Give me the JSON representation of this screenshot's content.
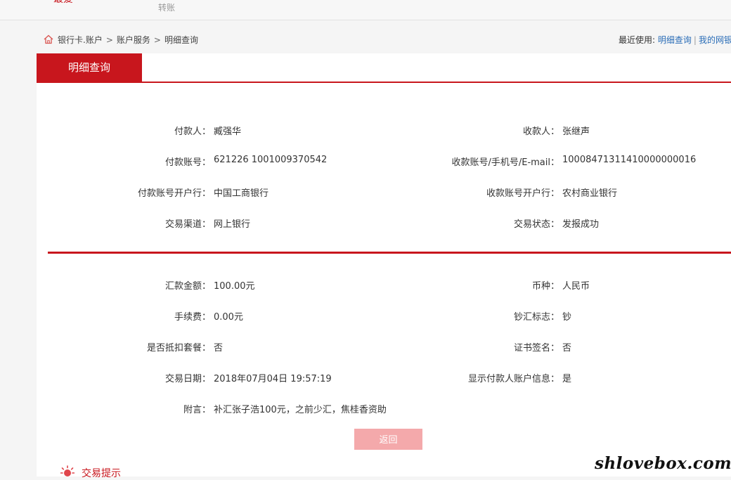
{
  "topbar": {
    "active_tab": "最爱",
    "transfer_tab": "转账"
  },
  "breadcrumb": {
    "items": [
      "银行卡.账户",
      "账户服务",
      "明细查询"
    ],
    "separator": ">"
  },
  "recent": {
    "label": "最近使用:",
    "links": [
      "明细查询",
      "我的网银"
    ],
    "divider": "|"
  },
  "panel": {
    "tab_title": "明细查询"
  },
  "details": {
    "payer_label": "付款人：",
    "payer": "臧强华",
    "payee_label": "收款人：",
    "payee": "张继声",
    "payer_account_label": "付款账号：",
    "payer_account": "621226 1001009370542",
    "payee_account_label": "收款账号/手机号/E-mail：",
    "payee_account": "10008471311410000000016",
    "payer_bank_label": "付款账号开户行：",
    "payer_bank": "中国工商银行",
    "payee_bank_label": "收款账号开户行：",
    "payee_bank": "农村商业银行",
    "channel_label": "交易渠道：",
    "channel": "网上银行",
    "status_label": "交易状态：",
    "status": "发报成功",
    "amount_label": "汇款金额：",
    "amount": "100.00元",
    "currency_label": "币种：",
    "currency": "人民币",
    "fee_label": "手续费：",
    "fee": "0.00元",
    "cash_flag_label": "钞汇标志：",
    "cash_flag": "钞",
    "package_label": "是否抵扣套餐：",
    "package": "否",
    "cert_sign_label": "证书签名：",
    "cert_sign": "否",
    "date_label": "交易日期：",
    "date": "2018年07月04日 19:57:19",
    "show_payer_label": "显示付款人账户信息：",
    "show_payer": "是",
    "memo_label": "附言：",
    "memo": "补汇张子浩100元，之前少汇，焦桂香资助"
  },
  "buttons": {
    "back": "返回"
  },
  "tips": {
    "label": "交易提示"
  },
  "watermark": "shlovebox.com",
  "colors": {
    "brand_red": "#c8161d",
    "button_pink": "#f4a9ab",
    "link_blue": "#2a6db7"
  }
}
